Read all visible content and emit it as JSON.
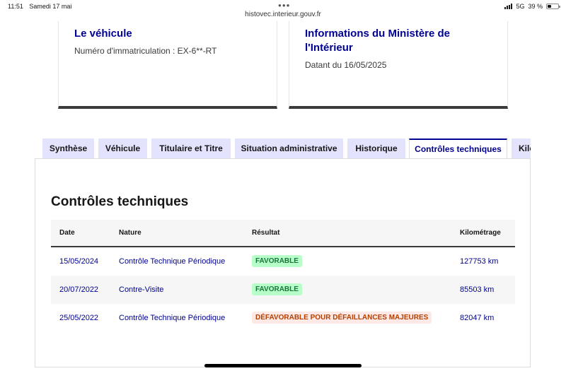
{
  "status_bar": {
    "time": "11:51",
    "date": "Samedi 17 mai",
    "url": "histovec.interieur.gouv.fr",
    "network": "5G",
    "battery": "39 %",
    "battery_level": 0.39
  },
  "cards": {
    "vehicle": {
      "title": "Le véhicule",
      "text": "Numéro d'immatriculation : EX-6**-RT"
    },
    "ministry": {
      "title": "Informations du Ministère de l'Intérieur",
      "text": "Datant du 16/05/2025"
    }
  },
  "tabs": [
    {
      "label": "Synthèse",
      "active": false
    },
    {
      "label": "Véhicule",
      "active": false
    },
    {
      "label": "Titulaire et Titre",
      "active": false
    },
    {
      "label": "Situation administrative",
      "active": false
    },
    {
      "label": "Historique",
      "active": false
    },
    {
      "label": "Contrôles techniques",
      "active": true
    },
    {
      "label": "Kilométrage",
      "active": false
    }
  ],
  "section": {
    "title": "Contrôles techniques",
    "columns": [
      "Date",
      "Nature",
      "Résultat",
      "Kilométrage"
    ],
    "rows": [
      {
        "date": "15/05/2024",
        "nature": "Contrôle Technique Périodique",
        "result": "FAVORABLE",
        "status": "good",
        "km": "127753 km"
      },
      {
        "date": "20/07/2022",
        "nature": "Contre-Visite",
        "result": "FAVORABLE",
        "status": "good",
        "km": "85503 km"
      },
      {
        "date": "25/05/2022",
        "nature": "Contrôle Technique Périodique",
        "result": "DÉFAVORABLE POUR DÉFAILLANCES MAJEURES",
        "status": "bad",
        "km": "82047 km"
      }
    ]
  },
  "colors": {
    "brand_blue": "#000091",
    "tab_bg": "#e3e3fd",
    "good_bg": "#b8fec9",
    "good_text": "#18753c",
    "bad_bg": "#ffe9e6",
    "bad_text": "#b34000"
  }
}
